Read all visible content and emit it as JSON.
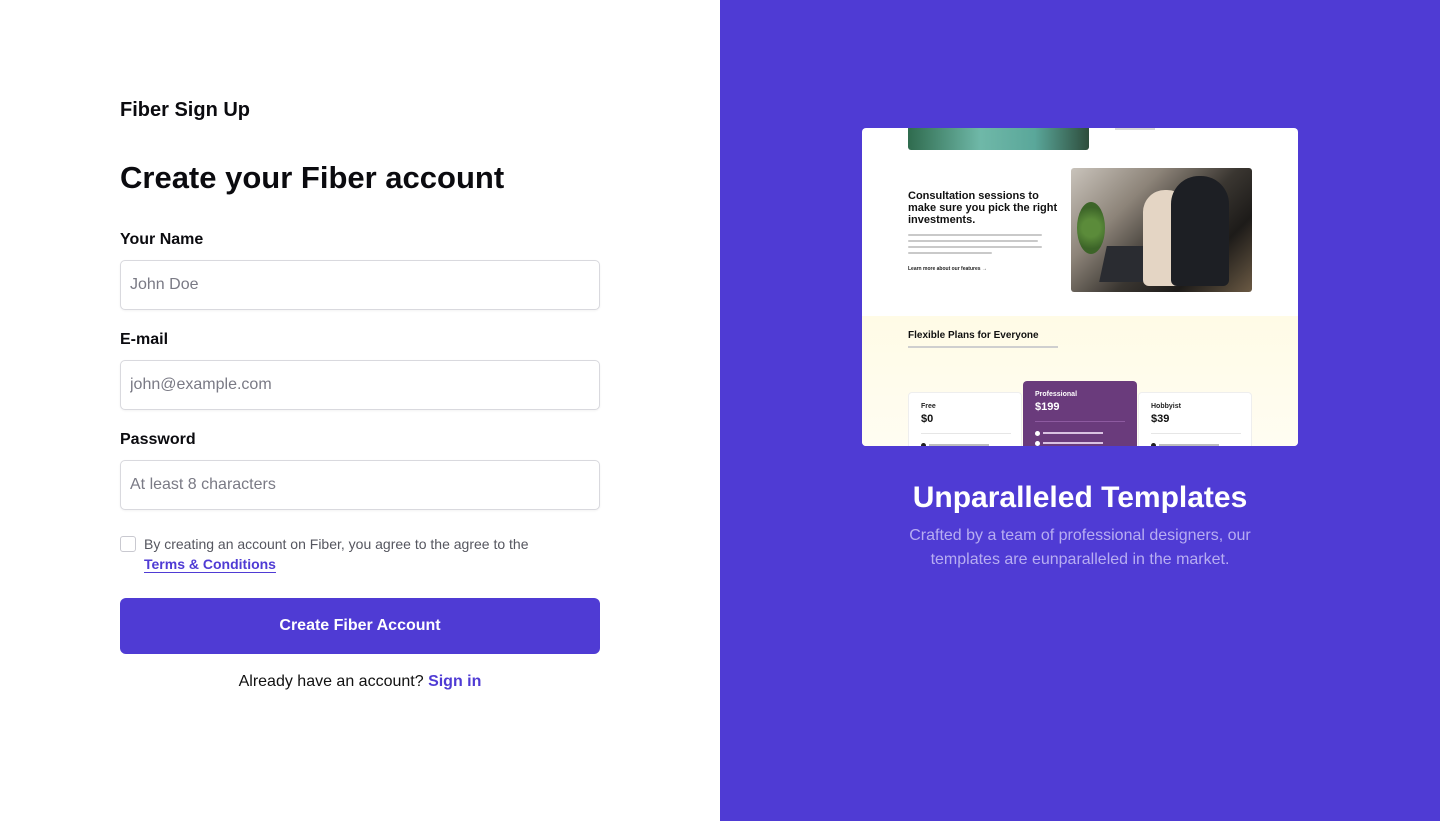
{
  "brand": {
    "title": "Fiber Sign Up"
  },
  "form": {
    "headline": "Create your Fiber account",
    "fields": [
      {
        "label": "Your Name",
        "placeholder": "John Doe",
        "value": ""
      },
      {
        "label": "E-mail",
        "placeholder": "john@example.com",
        "value": ""
      },
      {
        "label": "Password",
        "placeholder": "At least 8 characters",
        "value": ""
      }
    ],
    "terms": {
      "text": "By creating an account on Fiber, you agree to the agree to the",
      "link_label": "Terms & Conditions",
      "checked": false
    },
    "submit_label": "Create Fiber Account",
    "signin_prompt": "Already have an account?",
    "signin_link": "Sign in"
  },
  "promo": {
    "title": "Unparalleled Templates",
    "description": "Crafted by a team of professional designers, our templates are eunparalleled in the market.",
    "preview": {
      "section_title": "Consultation sessions to make sure you pick the right investments.",
      "learn_more": "Learn more about our features →",
      "plans_title": "Flexible Plans for Everyone",
      "plans": [
        {
          "name": "Free",
          "price": "$0"
        },
        {
          "name": "Professional",
          "price": "$199"
        },
        {
          "name": "Hobbyist",
          "price": "$39"
        }
      ]
    }
  },
  "colors": {
    "accent": "#4f3bd4",
    "promo_text": "#b7adf2",
    "pro_plan": "#6a3b7c"
  }
}
